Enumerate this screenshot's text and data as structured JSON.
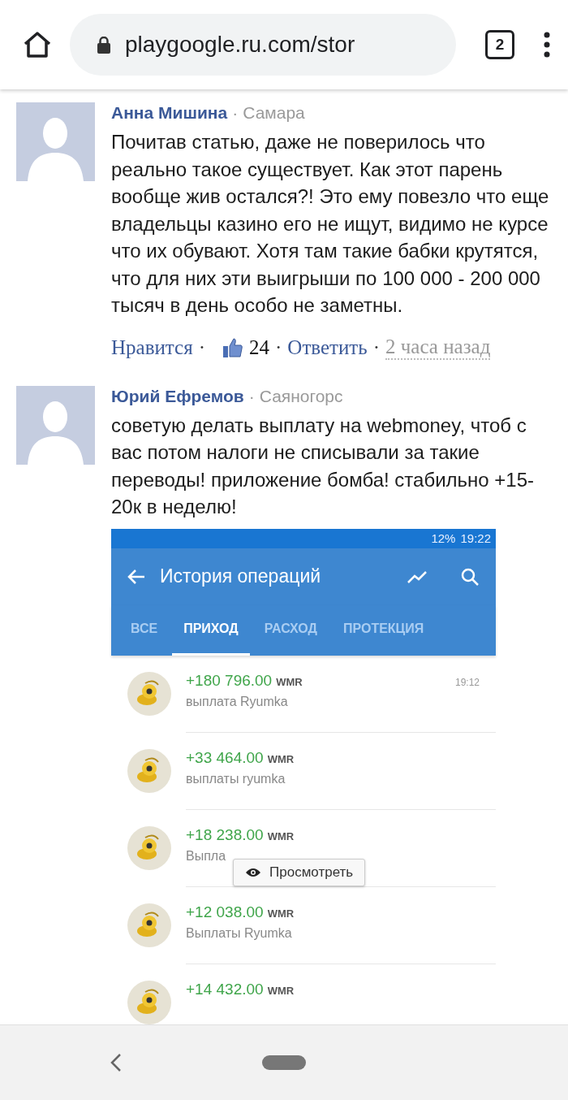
{
  "browser": {
    "url": "playgoogle.ru.com/stor",
    "tab_count": "2"
  },
  "comments": [
    {
      "author": "Анна Мишина",
      "separator": "·",
      "location": "Самара",
      "text": "Почитав статью, даже не поверилось что реально такое существует. Как этот парень вообще жив остался?! Это ему повезло что еще владельцы казино его не ищут, видимо не курсе что их обувают. Хотя там такие бабки крутятся, что для них эти выигрыши по 100 000 - 200 000 тысяч в день особо не заметны.",
      "actions": [
        {
          "kind": "link",
          "text": "Нравится"
        },
        {
          "kind": "sep",
          "text": "·"
        },
        {
          "kind": "likes",
          "text": "24"
        },
        {
          "kind": "sep",
          "text": "·"
        },
        {
          "kind": "link",
          "text": "Ответить"
        },
        {
          "kind": "sep",
          "text": "·"
        },
        {
          "kind": "time",
          "text": "2 часа назад"
        }
      ]
    },
    {
      "author": "Юрий Ефремов",
      "separator": "·",
      "location": "Саяногорс",
      "text": "советую делать выплату на webmoney, чтоб с вас потом налоги не списывали за такие переводы! приложение бомба! стабильно +15-20к в неделю!",
      "screenshot": {
        "battery": "12%",
        "clock": "19:22",
        "title": "История операций",
        "tabs": [
          {
            "label": "ВСЕ",
            "selected": false
          },
          {
            "label": "ПРИХОД",
            "selected": true
          },
          {
            "label": "РАСХОД",
            "selected": false
          },
          {
            "label": "ПРОТЕКЦИЯ",
            "selected": false
          }
        ],
        "transactions": [
          {
            "amount": "+180 796.00",
            "currency": "WMR",
            "description": "выплата Ryumka",
            "time": "19:12"
          },
          {
            "amount": "+33 464.00",
            "currency": "WMR",
            "description": "выплаты ryumka"
          },
          {
            "amount": "+18 238.00",
            "currency": "WMR",
            "description": "Выпла",
            "tooltip": "Просмотреть"
          },
          {
            "amount": "+12 038.00",
            "currency": "WMR",
            "description": "Выплаты Ryumka"
          },
          {
            "amount": "+14 432.00",
            "currency": "WMR"
          }
        ]
      }
    }
  ]
}
